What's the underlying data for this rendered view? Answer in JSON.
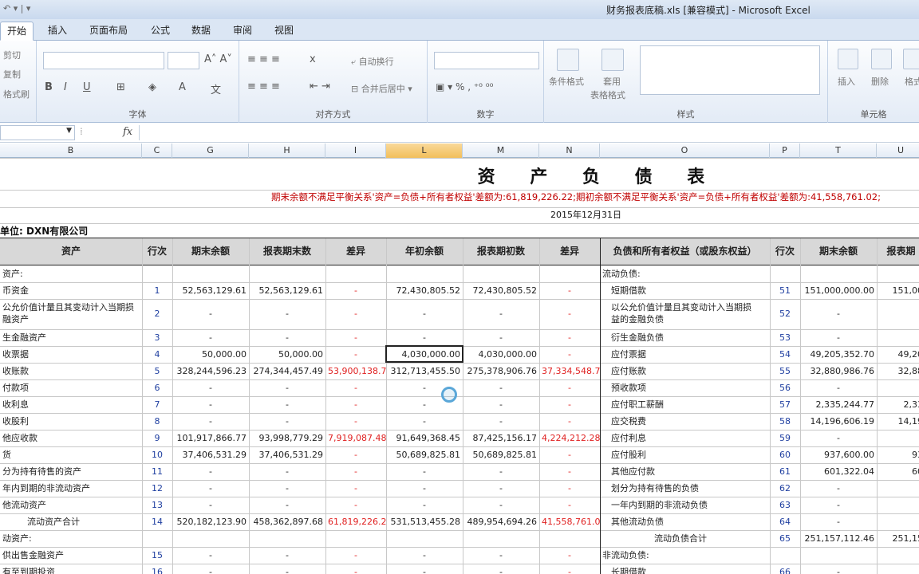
{
  "window": {
    "title": "财务报表底稿.xls  [兼容模式]  -  Microsoft Excel"
  },
  "tabs": [
    {
      "label": "开始",
      "active": true
    },
    {
      "label": "插入"
    },
    {
      "label": "页面布局"
    },
    {
      "label": "公式"
    },
    {
      "label": "数据"
    },
    {
      "label": "审阅"
    },
    {
      "label": "视图"
    }
  ],
  "ribbon": {
    "clipboard": {
      "cut": "剪切",
      "copy": "复制",
      "format_painter": "格式刷"
    },
    "font_group": "字体",
    "align_group": "对齐方式",
    "wrap_text": "自动换行",
    "merge_center": "合并后居中",
    "number_group": "数字",
    "conditional_format": "条件格式",
    "table_format_1": "套用",
    "table_format_2": "表格格式",
    "styles_group": "样式",
    "insert": "插入",
    "delete": "删除",
    "format": "格式",
    "cells_group": "单元格"
  },
  "formula_bar": {
    "fx": "fx"
  },
  "columns": [
    {
      "id": "B"
    },
    {
      "id": "C"
    },
    {
      "id": "G"
    },
    {
      "id": "H"
    },
    {
      "id": "I"
    },
    {
      "id": "L",
      "selected": true
    },
    {
      "id": "M"
    },
    {
      "id": "N"
    },
    {
      "id": "O"
    },
    {
      "id": "P"
    },
    {
      "id": "T"
    },
    {
      "id": "U"
    }
  ],
  "sheet": {
    "title": "资 产 负 债 表",
    "warning": "期末余额不满足平衡关系'资产=负债+所有者权益'差额为:61,819,226.22;期初余额不满足平衡关系'资产=负债+所有者权益'差额为:41,558,761.02;",
    "date": "2015年12月31日",
    "unit": "单位: DXN有限公司",
    "headers": [
      "资产",
      "行次",
      "期末余额",
      "报表期末数",
      "差异",
      "年初余额",
      "报表期初数",
      "差异",
      "负债和所有者权益（或股东权益）",
      "行次",
      "期末余额",
      "报表期"
    ],
    "rows": [
      {
        "a": "资产:",
        "c": "",
        "g": "",
        "h": "",
        "i": "",
        "l": "",
        "m": "",
        "n": "",
        "o": "流动负债:",
        "p": "",
        "t": "",
        "u": ""
      },
      {
        "a": "币资金",
        "c": "1",
        "g": "52,563,129.61",
        "h": "52,563,129.61",
        "i": "-",
        "l": "72,430,805.52",
        "m": "72,430,805.52",
        "n": "-",
        "o": "短期借款",
        "p": "51",
        "t": "151,000,000.00",
        "u": "151,00"
      },
      {
        "a": "公允价值计量且其变动计入当期损",
        "a2": "融资产",
        "c": "2",
        "g": "-",
        "h": "-",
        "i": "-",
        "l": "-",
        "m": "-",
        "n": "-",
        "o": "以公允价值计量且其变动计入当期损",
        "o2": "益的金融负债",
        "p": "52",
        "t": "-",
        "u": "",
        "tall": true
      },
      {
        "a": "生金融资产",
        "c": "3",
        "g": "-",
        "h": "-",
        "i": "-",
        "l": "-",
        "m": "-",
        "n": "-",
        "o": "衍生金融负债",
        "p": "53",
        "t": "-",
        "u": ""
      },
      {
        "a": "收票据",
        "c": "4",
        "g": "50,000.00",
        "h": "50,000.00",
        "i": "-",
        "l": "4,030,000.00",
        "m": "4,030,000.00",
        "n": "-",
        "o": "应付票据",
        "p": "54",
        "t": "49,205,352.70",
        "u": "49,20"
      },
      {
        "a": "收账款",
        "c": "5",
        "g": "328,244,596.23",
        "h": "274,344,457.49",
        "i": "53,900,138.74",
        "l": "312,713,455.50",
        "m": "275,378,906.76",
        "n": "37,334,548.74",
        "o": "应付账款",
        "p": "55",
        "t": "32,880,986.76",
        "u": "32,88"
      },
      {
        "a": "付款项",
        "c": "6",
        "g": "-",
        "h": "-",
        "i": "-",
        "l": "-",
        "m": "-",
        "n": "-",
        "o": "预收款项",
        "p": "56",
        "t": "-",
        "u": ""
      },
      {
        "a": "收利息",
        "c": "7",
        "g": "-",
        "h": "-",
        "i": "-",
        "l": "-",
        "m": "-",
        "n": "-",
        "o": "应付职工薪酬",
        "p": "57",
        "t": "2,335,244.77",
        "u": "2,33"
      },
      {
        "a": "收股利",
        "c": "8",
        "g": "-",
        "h": "-",
        "i": "-",
        "l": "-",
        "m": "-",
        "n": "-",
        "o": "应交税费",
        "p": "58",
        "t": "14,196,606.19",
        "u": "14,19"
      },
      {
        "a": "他应收款",
        "c": "9",
        "g": "101,917,866.77",
        "h": "93,998,779.29",
        "i": "7,919,087.48",
        "l": "91,649,368.45",
        "m": "87,425,156.17",
        "n": "4,224,212.28",
        "o": "应付利息",
        "p": "59",
        "t": "-",
        "u": ""
      },
      {
        "a": "货",
        "c": "10",
        "g": "37,406,531.29",
        "h": "37,406,531.29",
        "i": "-",
        "l": "50,689,825.81",
        "m": "50,689,825.81",
        "n": "-",
        "o": "应付股利",
        "p": "60",
        "t": "937,600.00",
        "u": "93"
      },
      {
        "a": "分为持有待售的资产",
        "c": "11",
        "g": "-",
        "h": "-",
        "i": "-",
        "l": "-",
        "m": "-",
        "n": "-",
        "o": "其他应付款",
        "p": "61",
        "t": "601,322.04",
        "u": "60"
      },
      {
        "a": "年内到期的非流动资产",
        "c": "12",
        "g": "-",
        "h": "-",
        "i": "-",
        "l": "-",
        "m": "-",
        "n": "-",
        "o": "划分为持有待售的负债",
        "p": "62",
        "t": "-",
        "u": ""
      },
      {
        "a": "他流动资产",
        "c": "13",
        "g": "-",
        "h": "-",
        "i": "-",
        "l": "-",
        "m": "-",
        "n": "-",
        "o": "一年内到期的非流动负债",
        "p": "63",
        "t": "-",
        "u": ""
      },
      {
        "a": "流动资产合计",
        "c": "14",
        "g": "520,182,123.90",
        "h": "458,362,897.68",
        "i": "61,819,226.22",
        "l": "531,513,455.28",
        "m": "489,954,694.26",
        "n": "41,558,761.02",
        "o": "其他流动负债",
        "p": "64",
        "t": "-",
        "u": "",
        "a_indent": true
      },
      {
        "a": "动资产:",
        "c": "",
        "g": "",
        "h": "",
        "i": "",
        "l": "",
        "m": "",
        "n": "",
        "o": "流动负债合计",
        "p": "65",
        "t": "251,157,112.46",
        "u": "251,15",
        "o_indent": true
      },
      {
        "a": "供出售金融资产",
        "c": "15",
        "g": "-",
        "h": "-",
        "i": "-",
        "l": "-",
        "m": "-",
        "n": "-",
        "o": "非流动负债:",
        "p": "",
        "t": "",
        "u": ""
      },
      {
        "a": "有至到期投资",
        "c": "16",
        "g": "-",
        "h": "-",
        "i": "-",
        "l": "-",
        "m": "-",
        "n": "-",
        "o": "长期借款",
        "p": "66",
        "t": "-",
        "u": ""
      }
    ]
  }
}
